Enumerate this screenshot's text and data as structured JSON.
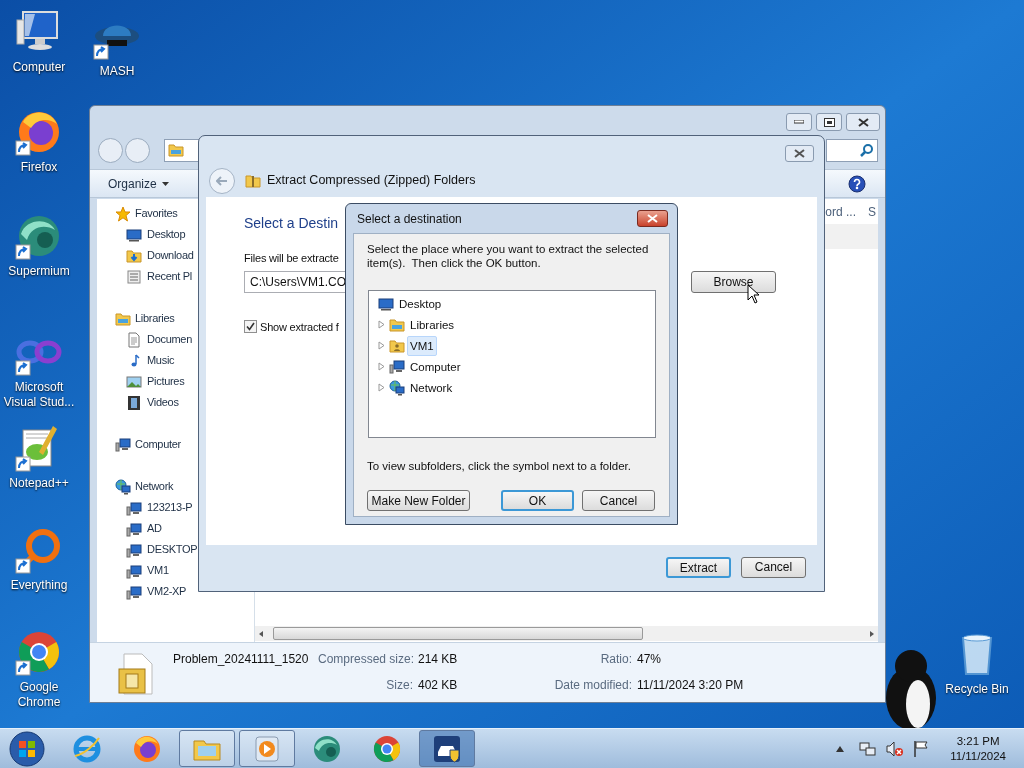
{
  "desktop": {
    "shortcuts": [
      {
        "label": "Computer",
        "shortcut": false
      },
      {
        "label": "MASH",
        "shortcut": true
      },
      {
        "label": "Firefox",
        "shortcut": true
      },
      {
        "label": "Supermium",
        "shortcut": true
      },
      {
        "label": "Microsoft Visual Stud...",
        "shortcut": true
      },
      {
        "label": "Notepad++",
        "shortcut": true
      },
      {
        "label": "Everything",
        "shortcut": true
      },
      {
        "label": "Google Chrome",
        "shortcut": true
      },
      {
        "label": "Recycle Bin",
        "shortcut": false
      }
    ]
  },
  "explorer": {
    "toolbar": {
      "organize": "Organize"
    },
    "columns": [
      "ord ...",
      "S"
    ],
    "sidebar": [
      {
        "label": "Favorites",
        "children": [
          {
            "label": "Desktop"
          },
          {
            "label": "Download"
          },
          {
            "label": "Recent Pl"
          }
        ]
      },
      {
        "label": "Libraries",
        "children": [
          {
            "label": "Documen"
          },
          {
            "label": "Music"
          },
          {
            "label": "Pictures"
          },
          {
            "label": "Videos"
          }
        ]
      },
      {
        "label": "Computer"
      },
      {
        "label": "Network",
        "children": [
          {
            "label": "123213-P"
          },
          {
            "label": "AD"
          },
          {
            "label": "DESKTOP"
          },
          {
            "label": "VM1"
          },
          {
            "label": "VM2-XP"
          }
        ]
      }
    ],
    "details": {
      "name": "Problem_20241111_1520",
      "fields": [
        {
          "label": "Compressed size:",
          "value": "214 KB"
        },
        {
          "label": "Ratio:",
          "value": "47%"
        },
        {
          "label": "Size:",
          "value": "402 KB"
        },
        {
          "label": "Date modified:",
          "value": "11/11/2024 3:20 PM"
        }
      ]
    }
  },
  "extract_dialog": {
    "title": "Extract Compressed (Zipped) Folders",
    "heading": "Select a Destin",
    "path_label": "Files will be extracte",
    "path": "C:\\Users\\VM1.CO",
    "browse": "Browse",
    "show_files": {
      "label": "Show extracted f",
      "checked": true
    },
    "buttons": [
      {
        "label": "Extract",
        "default": true
      },
      {
        "label": "Cancel",
        "default": false
      }
    ]
  },
  "destination_dialog": {
    "title": "Select a destination",
    "instructions": "Select the place where you want to extract the selected item(s).  Then click the OK button.",
    "tree": [
      {
        "label": "Desktop",
        "selected": false,
        "children": [
          {
            "label": "Libraries",
            "expanded": false,
            "selected": false
          },
          {
            "label": "VM1",
            "expanded": false,
            "selected": true
          },
          {
            "label": "Computer",
            "expanded": false,
            "selected": false
          },
          {
            "label": "Network",
            "expanded": false,
            "selected": false
          }
        ]
      }
    ],
    "hint": "To view subfolders, click the symbol next to a folder.",
    "buttons": [
      {
        "label": "Make New Folder",
        "default": false
      },
      {
        "label": "OK",
        "default": true
      },
      {
        "label": "Cancel",
        "default": false
      }
    ]
  },
  "taskbar": {
    "apps": [
      {
        "running": false,
        "active": false
      },
      {
        "running": false,
        "active": false
      },
      {
        "running": true,
        "active": false
      },
      {
        "running": true,
        "active": false
      },
      {
        "running": false,
        "active": false
      },
      {
        "running": false,
        "active": false
      },
      {
        "running": true,
        "active": true
      }
    ],
    "clock": {
      "time": "3:21 PM",
      "date": "11/11/2024"
    }
  }
}
